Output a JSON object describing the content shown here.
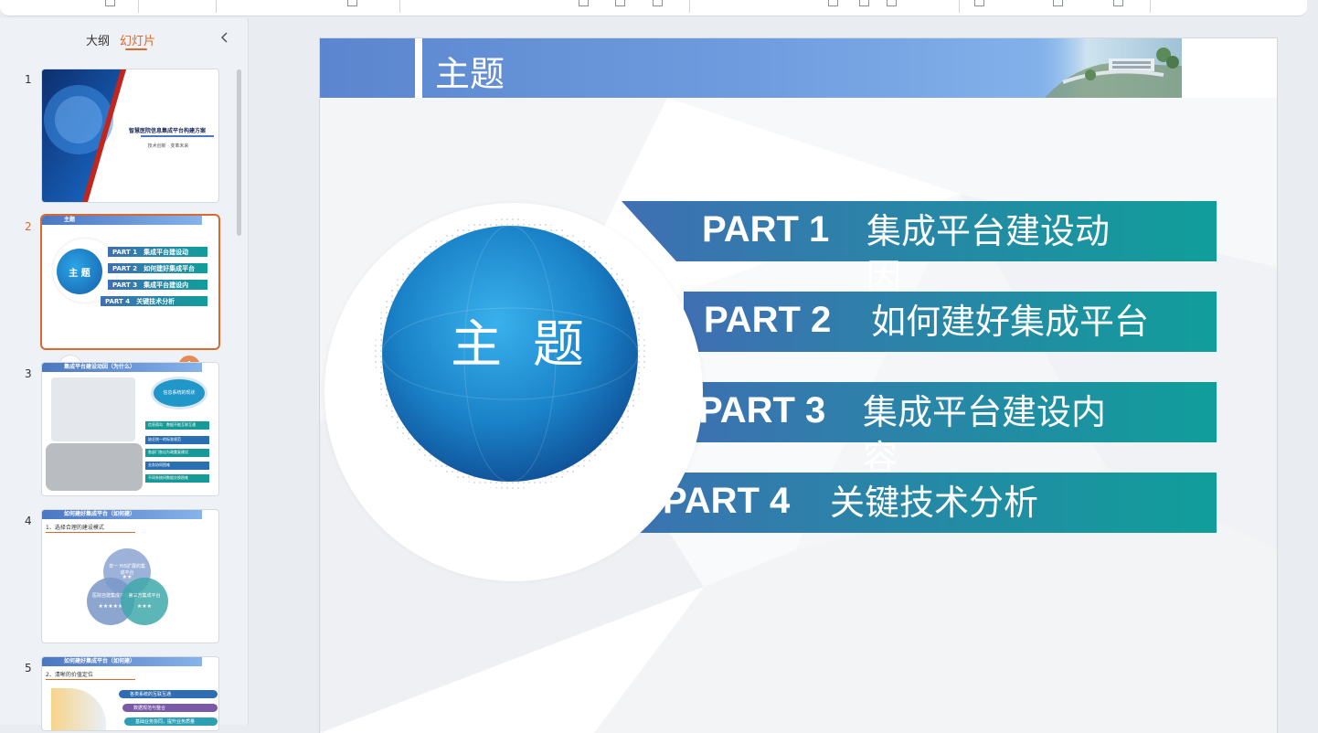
{
  "panel": {
    "tabs": [
      {
        "label": "大纲",
        "active": false
      },
      {
        "label": "幻灯片",
        "active": true
      }
    ],
    "accent_color": "#d9692f",
    "slides": [
      {
        "number": "1",
        "title": "智慧医院信息集成平台构建方案",
        "subtitle": "技术创新 · 变革未来"
      },
      {
        "number": "2",
        "title": "主题",
        "center": "主 题",
        "parts": [
          "PART 1　集成平台建设动",
          "PART 2　如何建好集成平台",
          "PART 3　集成平台建设内",
          "PART 4　关键技术分析"
        ]
      },
      {
        "number": "3",
        "title": "集成平台建设动因（为什么）",
        "bubble": "信息系统的现状",
        "rows": [
          "信息孤岛：数据不能互联互通",
          "缺乏统一的标准规范",
          "各部门各自为政重复建设",
          "业务协同困难",
          "不同系统间数据交换困难"
        ]
      },
      {
        "number": "4",
        "title": "如何建好集成平台（如何建）",
        "subtitle": "1、选择合理的建设模式",
        "circles": [
          "单一 HIS扩展的集成平台",
          "医院自建集成平台",
          "第三方集成平台"
        ],
        "stars": [
          "★★",
          "★★★★★",
          "★★★"
        ]
      },
      {
        "number": "5",
        "title": "如何建好集成平台（如何建）",
        "subtitle": "2、清晰的价值定位",
        "rows": [
          "各类系统的互联互通",
          "数据规范与整合",
          "基础业务协同，提升业务质量"
        ]
      }
    ]
  },
  "slide": {
    "title": "主题",
    "center_label": "主 题",
    "parts": [
      {
        "num": "PART 1",
        "name": "集成平台建设动因"
      },
      {
        "num": "PART 2",
        "name": "如何建好集成平台"
      },
      {
        "num": "PART 3",
        "name": "集成平台建设内容"
      },
      {
        "num": "PART 4",
        "name": "关键技术分析"
      }
    ],
    "colors": {
      "title_bar": "#6a96da",
      "part_left": "#3f6fb3",
      "part_right": "#109e9a",
      "sphere": "#1a82c8"
    }
  }
}
